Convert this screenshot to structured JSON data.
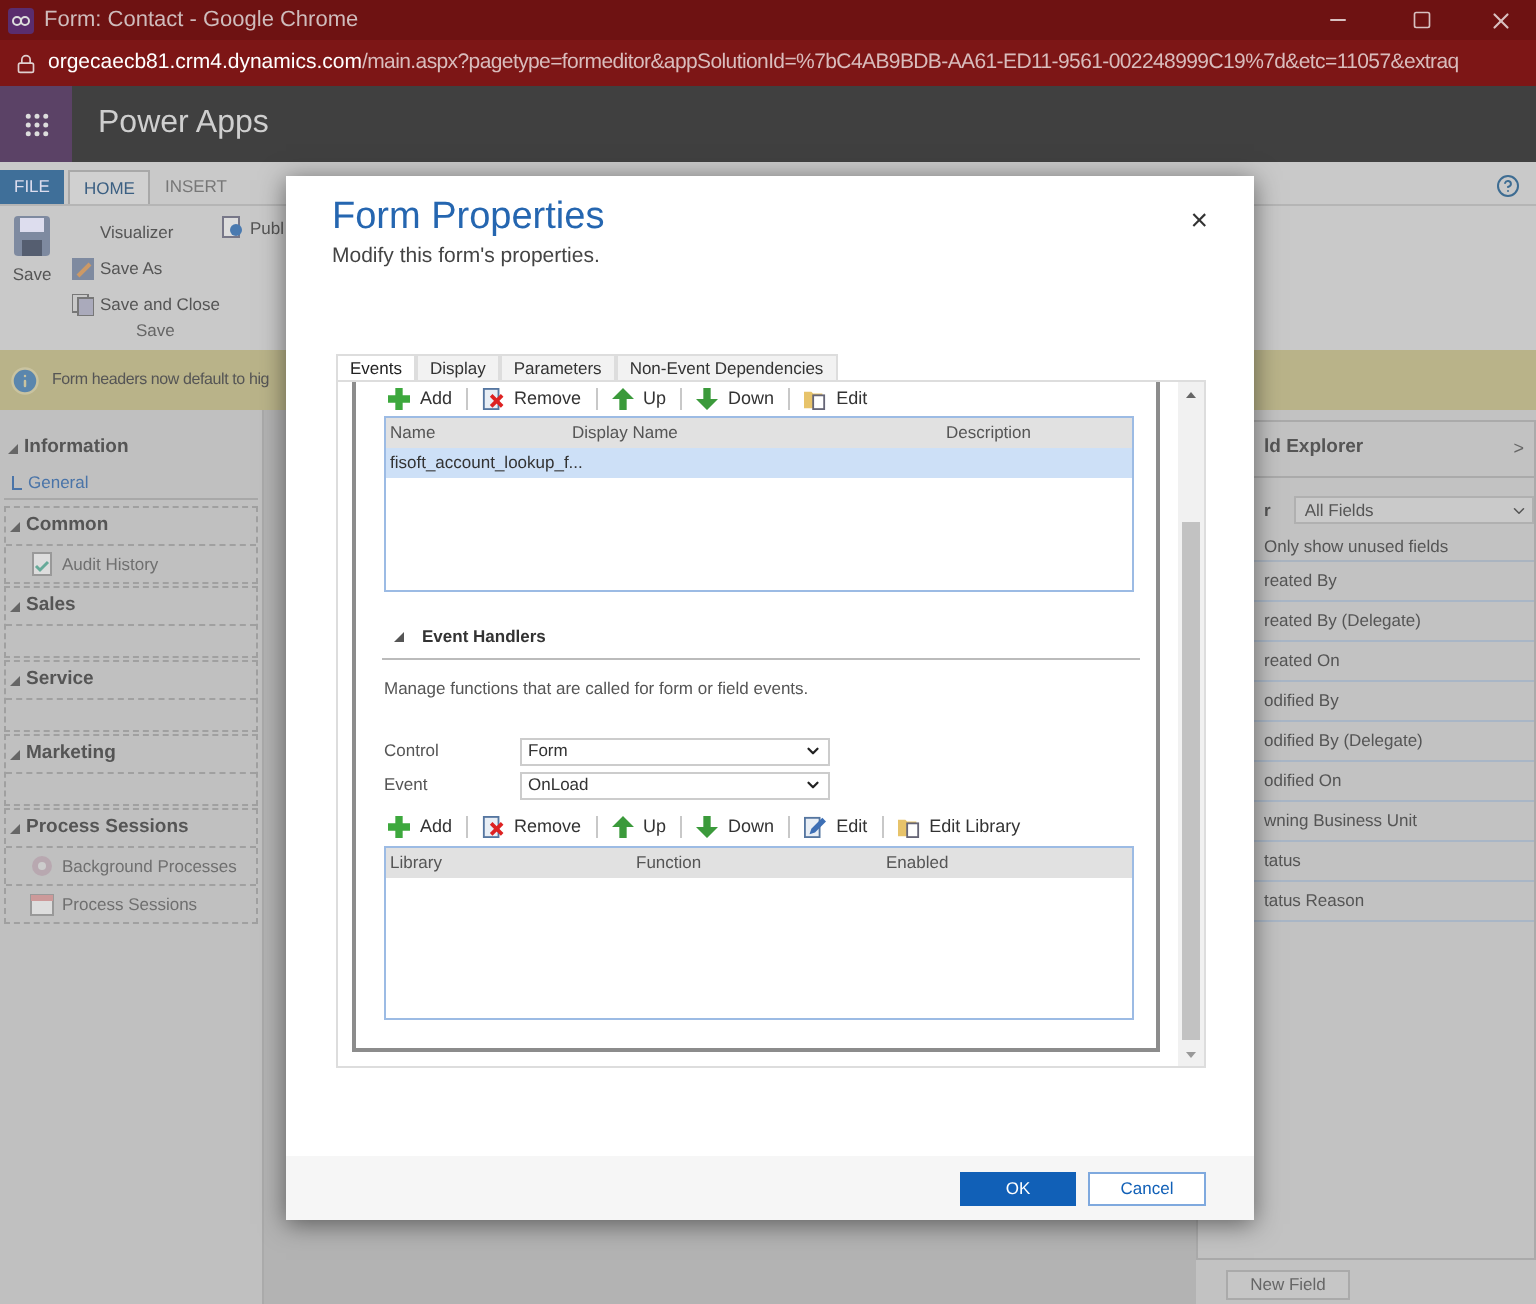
{
  "browser": {
    "title": "Form: Contact - Google Chrome",
    "url_host": "orgecaecb81.crm4.dynamics.com",
    "url_path": "/main.aspx?pagetype=formeditor&appSolutionId=%7bC4AB9BDB-AA61-ED11-9561-002248999C19%7d&etc=11057&extraq"
  },
  "app": {
    "name": "Power Apps"
  },
  "ribbon": {
    "tabs": [
      {
        "label": "FILE",
        "kind": "file",
        "selected": false
      },
      {
        "label": "HOME",
        "kind": "tab",
        "selected": true
      },
      {
        "label": "INSERT",
        "kind": "tab",
        "selected": false
      }
    ],
    "save_button": "Save",
    "commands": [
      {
        "label": "Visualizer",
        "kind": "plain"
      },
      {
        "label": "Save As",
        "kind": "save-as"
      },
      {
        "label": "Save and Close",
        "kind": "save-close"
      }
    ],
    "publish": "Publ",
    "group_label": "Save"
  },
  "info_bar": {
    "text": "Form headers now default to hig"
  },
  "left_nav": [
    {
      "title": "Information",
      "items": [
        {
          "label": "General",
          "kind": "link"
        }
      ]
    },
    {
      "title": "Common",
      "items": [
        {
          "label": "Audit History",
          "kind": "audit"
        }
      ]
    },
    {
      "title": "Sales"
    },
    {
      "title": "Service"
    },
    {
      "title": "Marketing"
    },
    {
      "title": "Process Sessions",
      "items": [
        {
          "label": "Background Processes",
          "kind": "gear"
        },
        {
          "label": "Process Sessions",
          "kind": "calendar"
        }
      ]
    }
  ],
  "field_explorer": {
    "title": "ld Explorer",
    "collapse": ">",
    "filter_label": "r",
    "filter_value": "All Fields",
    "unused_label": "Only show unused fields",
    "fields": [
      "reated By",
      "reated By (Delegate)",
      "reated On",
      "odified By",
      "odified By (Delegate)",
      "odified On",
      "wning Business Unit",
      "tatus",
      "tatus Reason"
    ],
    "new_field": "New Field"
  },
  "dialog": {
    "title": "Form Properties",
    "subtitle": "Modify this form's properties.",
    "close": "×",
    "tabs": [
      {
        "label": "Events",
        "selected": true
      },
      {
        "label": "Display",
        "selected": false
      },
      {
        "label": "Parameters",
        "selected": false
      },
      {
        "label": "Non-Event Dependencies",
        "selected": false
      }
    ],
    "library_toolbar": [
      {
        "label": "Add",
        "kind": "add"
      },
      {
        "label": "Remove",
        "kind": "remove"
      },
      {
        "label": "Up",
        "kind": "up"
      },
      {
        "label": "Down",
        "kind": "down"
      },
      {
        "label": "Edit",
        "kind": "folder"
      }
    ],
    "library_columns": [
      "Name",
      "Display Name",
      "Description"
    ],
    "library_rows": [
      {
        "name": "fisoft_account_lookup_f...",
        "selected": true
      }
    ],
    "handlers_title": "Event Handlers",
    "handlers_description": "Manage functions that are called for form or field events.",
    "control": {
      "label": "Control",
      "value": "Form"
    },
    "event": {
      "label": "Event",
      "value": "OnLoad"
    },
    "handlers_toolbar": [
      {
        "label": "Add",
        "kind": "add"
      },
      {
        "label": "Remove",
        "kind": "remove"
      },
      {
        "label": "Up",
        "kind": "up"
      },
      {
        "label": "Down",
        "kind": "down"
      },
      {
        "label": "Edit",
        "kind": "pen"
      },
      {
        "label": "Edit Library",
        "kind": "folder"
      }
    ],
    "handlers_columns": [
      "Library",
      "Function",
      "Enabled"
    ],
    "ok": "OK",
    "cancel": "Cancel"
  }
}
